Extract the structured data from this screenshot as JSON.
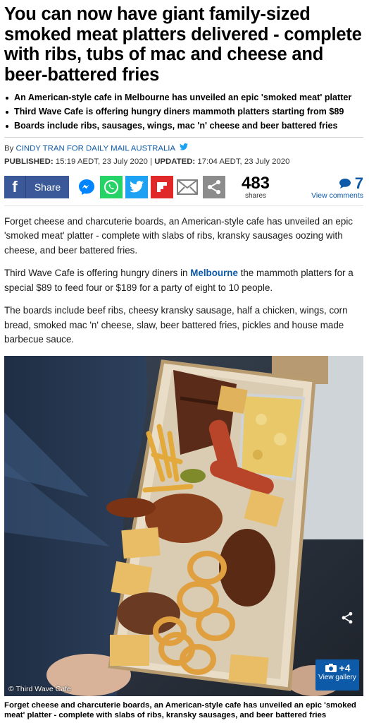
{
  "article": {
    "headline": "You can now have giant family-sized smoked meat platters delivered - complete with ribs, tubs of mac and cheese and beer-battered fries",
    "bullets": [
      "An American-style cafe in Melbourne has unveiled an epic 'smoked meat' platter",
      "Third Wave Cafe is offering hungry diners mammoth platters starting from $89",
      "Boards include ribs, sausages, wings, mac 'n' cheese and beer battered fries"
    ],
    "byline": {
      "prefix": "By",
      "author": "CINDY TRAN FOR DAILY MAIL AUSTRALIA",
      "published_label": "PUBLISHED:",
      "published": "15:19 AEDT, 23 July 2020",
      "separator": "|",
      "updated_label": "UPDATED:",
      "updated": "17:04 AEDT, 23 July 2020"
    },
    "share": {
      "share_label": "Share",
      "share_count": "483",
      "shares_label": "shares",
      "comment_count": "7",
      "comments_label": "View comments"
    },
    "paragraphs": {
      "p1": "Forget cheese and charcuterie boards, an American-style cafe has unveiled an epic 'smoked meat' platter - complete with slabs of ribs, kransky sausages oozing with cheese, and beer battered fries.",
      "p2_before": "Third Wave Cafe is offering hungry diners in ",
      "p2_link": "Melbourne",
      "p2_after": " the mammoth platters for a special $89 to feed four or $189 for a party of eight to 10 people.",
      "p3": "The boards include beef ribs, cheesy kransky sausage, half a chicken, wings, corn bread, smoked mac 'n' cheese, slaw, beer battered fries, pickles and house made barbecue sauce."
    },
    "photo": {
      "credit": "© Third Wave Cafe",
      "gallery_count": "+4",
      "gallery_label": "View gallery",
      "caption": "Forget cheese and charcuterie boards, an American-style cafe has unveiled an epic 'smoked meat' platter - complete with slabs of ribs, kransky sausages, and beer battered fries"
    }
  },
  "colors": {
    "link_blue": "#0c5aa8",
    "facebook": "#3b5998",
    "messenger": "#0084ff",
    "whatsapp": "#25d366",
    "twitter": "#1da1f2",
    "flipboard": "#e12828",
    "email": "#808080"
  },
  "icons": [
    "facebook-icon",
    "messenger-icon",
    "whatsapp-icon",
    "twitter-icon",
    "flipboard-icon",
    "email-icon",
    "share-icon",
    "comment-bubble-icon",
    "camera-icon",
    "twitter-bird-icon"
  ]
}
